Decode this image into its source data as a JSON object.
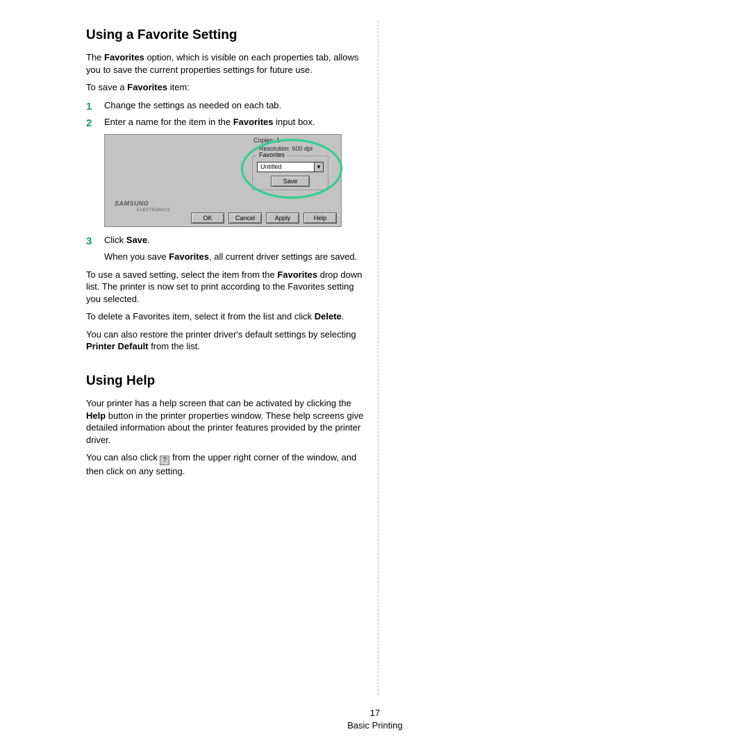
{
  "section1": {
    "heading": "Using a Favorite Setting",
    "intro_a": "The ",
    "intro_b": "Favorites",
    "intro_c": " option, which is visible on each properties tab, allows you to save the current properties settings for future use.",
    "tosave_a": "To save a ",
    "tosave_b": "Favorites",
    "tosave_c": " item:",
    "steps": {
      "n1": "1",
      "s1": "Change the settings as needed on each tab.",
      "n2": "2",
      "s2_a": "Enter a name for the item in the ",
      "s2_b": "Favorites",
      "s2_c": " input box.",
      "n3": "3",
      "s3_a": "Click ",
      "s3_b": "Save",
      "s3_c": ".",
      "s3_sub_a": "When you save ",
      "s3_sub_b": "Favorites",
      "s3_sub_c": ", all current driver settings are saved."
    },
    "use_a": "To use a saved setting, select the item from the ",
    "use_b": "Favorites",
    "use_c": " drop down list. The printer is now set to print according to the Favorites setting you selected.",
    "del_a": "To delete a Favorites item, select it from the list and click ",
    "del_b": "Delete",
    "del_c": ".",
    "restore_a": "You can also restore the printer driver's default settings by selecting ",
    "restore_b": "Printer Default",
    "restore_c": " from the list."
  },
  "shot": {
    "copies": "Copies: 1",
    "resolution": "Resolution: 600 dpi",
    "favorites_label": "Favorites",
    "dropdown_value": "Untitled",
    "save": "Save",
    "brand": "SAMSUNG",
    "brand_sub": "ELECTRONICS",
    "ok": "OK",
    "cancel": "Cancel",
    "apply": "Apply",
    "help": "Help"
  },
  "section2": {
    "heading": "Using Help",
    "p1_a": "Your printer has a help screen that can be activated by clicking the ",
    "p1_b": "Help",
    "p1_c": " button in the printer properties window. These help screens give detailed information about the printer features provided by the printer driver.",
    "p2_a": "You can also click ",
    "p2_b": " from the upper right corner of the window, and then click on any setting.",
    "qmark": "?"
  },
  "footer": {
    "page": "17",
    "chapter": "Basic Printing"
  }
}
